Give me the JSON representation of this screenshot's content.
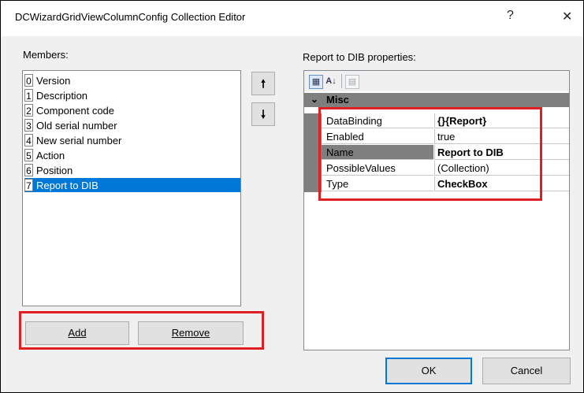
{
  "window": {
    "title": "DCWizardGridViewColumnConfig Collection Editor",
    "help_label": "?",
    "close_label": "✕"
  },
  "members": {
    "label": "Members:",
    "items": [
      {
        "index": "0",
        "label": "Version"
      },
      {
        "index": "1",
        "label": "Description"
      },
      {
        "index": "2",
        "label": "Component code"
      },
      {
        "index": "3",
        "label": "Old serial number"
      },
      {
        "index": "4",
        "label": "New serial number"
      },
      {
        "index": "5",
        "label": "Action"
      },
      {
        "index": "6",
        "label": "Position"
      },
      {
        "index": "7",
        "label": "Report to DIB"
      }
    ],
    "selected_index": 7,
    "move_up": "🠕",
    "move_down": "🠗",
    "add_label": "Add",
    "remove_label": "Remove"
  },
  "properties": {
    "label": "Report to DIB properties:",
    "category": "Misc",
    "rows": [
      {
        "name": "DataBinding",
        "value": "{}{Report}",
        "bold": true
      },
      {
        "name": "Enabled",
        "value": "true",
        "bold": false
      },
      {
        "name": "Name",
        "value": "Report to DIB",
        "bold": true
      },
      {
        "name": "PossibleValues",
        "value": "(Collection)",
        "bold": false
      },
      {
        "name": "Type",
        "value": "CheckBox",
        "bold": true
      }
    ],
    "selected_row": 2
  },
  "footer": {
    "ok_label": "OK",
    "cancel_label": "Cancel"
  },
  "colors": {
    "selection": "#0078d7",
    "highlight_box": "#e02020",
    "category_bg": "#7f7f7f"
  }
}
